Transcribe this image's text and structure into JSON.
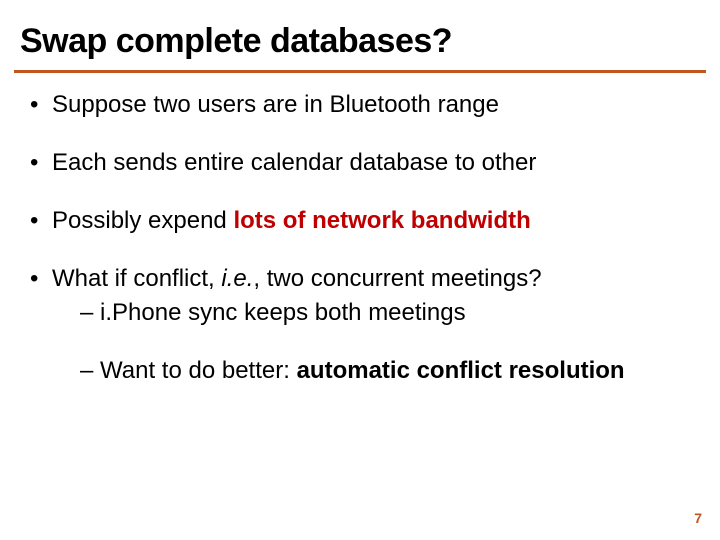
{
  "title": "Swap complete databases?",
  "bullets": {
    "b1": "Suppose two users are in Bluetooth range",
    "b2": "Each sends entire calendar database to other",
    "b3_pre": "Possibly expend ",
    "b3_em": "lots of network bandwidth",
    "b4_pre": "What if conflict, ",
    "b4_ie": "i.e.",
    "b4_post": ", two concurrent meetings?",
    "b4_sub1": "– i.Phone sync keeps both meetings",
    "b4_sub2_pre": "– Want to do better: ",
    "b4_sub2_em": "automatic conflict resolution"
  },
  "page_number": "7"
}
